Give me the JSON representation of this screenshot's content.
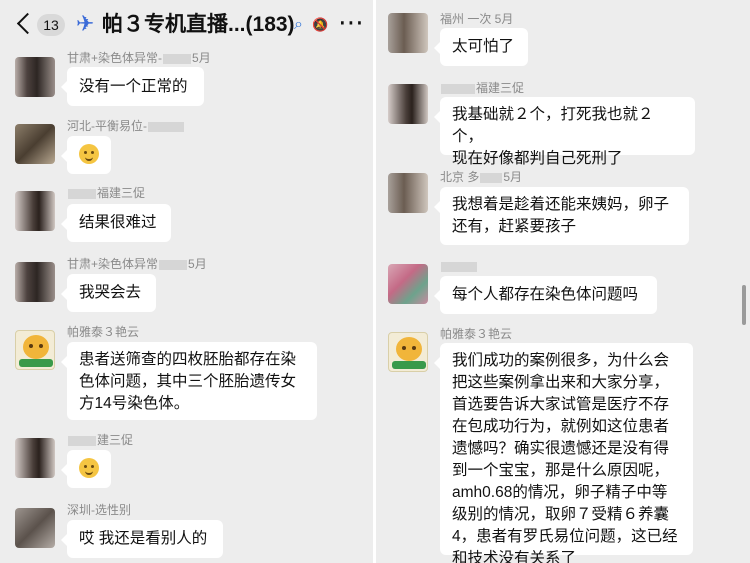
{
  "header": {
    "back_badge": "13",
    "plane_icon": "✈",
    "title": "帕３专机直播...",
    "member_count": "(183)",
    "search_icon": "⌕",
    "mute_icon": "🔕",
    "more_icon": "⋯"
  },
  "left_messages": [
    {
      "name": "甘肃+染色体异常-",
      "name_suffix": "5月",
      "text": "没有一个正常的"
    },
    {
      "name": "河北-平衡易位-",
      "name_suffix": "",
      "text": ""
    },
    {
      "name": "",
      "name_suffix": "福建三促",
      "text": "结果很难过"
    },
    {
      "name": "甘肃+染色体异常",
      "name_suffix": "5月",
      "text": "我哭会去"
    },
    {
      "name": "帕雅泰３艳云",
      "name_suffix": "",
      "text": "患者送筛查的四枚胚胎都存在染\n色体问题，其中三个胚胎遗传女\n方14号染色体。"
    },
    {
      "name": "",
      "name_suffix": "建三促",
      "text": ""
    },
    {
      "name": "深圳-选性别",
      "name_suffix": "",
      "text": "哎 我还是看别人的"
    }
  ],
  "right_messages": [
    {
      "name": "福州 一次 5月",
      "name_suffix": "",
      "text": "太可怕了"
    },
    {
      "name": "",
      "name_suffix": "福建三促",
      "text": "我基础就２个，打死我也就２个，\n现在好像都判自己死刑了"
    },
    {
      "name": "北京 多",
      "name_suffix": "5月",
      "text": "我想着是趁着还能来姨妈，卵子\n还有，赶紧要孩子"
    },
    {
      "name": "",
      "name_suffix": "",
      "text": "每个人都存在染色体问题吗"
    },
    {
      "name": "帕雅泰３艳云",
      "name_suffix": "",
      "text": "我们成功的案例很多，为什么会\n把这些案例拿出来和大家分享，\n首选要告诉大家试管是医疗不存\n在包成功行为，就例如这位患者\n遗憾吗？确实很遗憾还是没有得\n到一个宝宝，那是什么原因呢，\namh0.68的情况，卵子精子中等\n级别的情况，取卵７受精６养囊\n4，患者有罗氏易位问题，这已经\n和技术没有关系了"
    }
  ]
}
